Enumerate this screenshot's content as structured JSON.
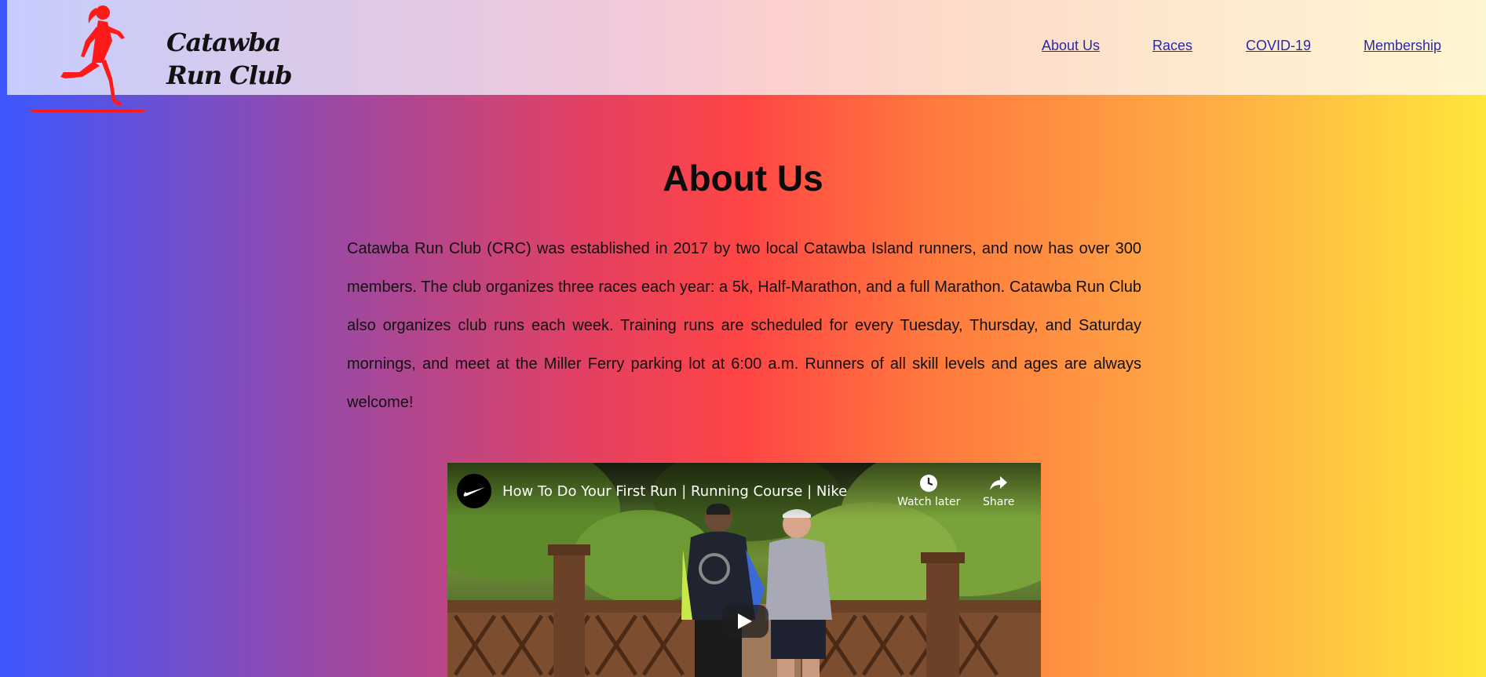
{
  "header": {
    "brand_line1": "Catawba",
    "brand_line2": "Run Club",
    "nav": [
      {
        "label": "About Us"
      },
      {
        "label": "Races"
      },
      {
        "label": "COVID-19"
      },
      {
        "label": "Membership"
      }
    ]
  },
  "main": {
    "title": "About Us",
    "paragraph": "Catawba Run Club (CRC) was established in 2017 by two local Catawba Island runners, and now has over 300 members. The club organizes three races each year: a 5k, Half-Marathon, and a full Marathon. Catawba Run Club also organizes club runs each week. Training runs are scheduled for every Tuesday, Thursday, and Saturday mornings, and meet at the Miller Ferry parking lot at 6:00 a.m. Runners of all skill levels and ages are always welcome!"
  },
  "video": {
    "title": "How To Do Your First Run | Running Course | Nike",
    "watch_later_label": "Watch later",
    "share_label": "Share",
    "channel_icon": "nike-swoosh-icon"
  },
  "colors": {
    "runner": "#ff1a1a",
    "link": "#2a2aa8"
  }
}
